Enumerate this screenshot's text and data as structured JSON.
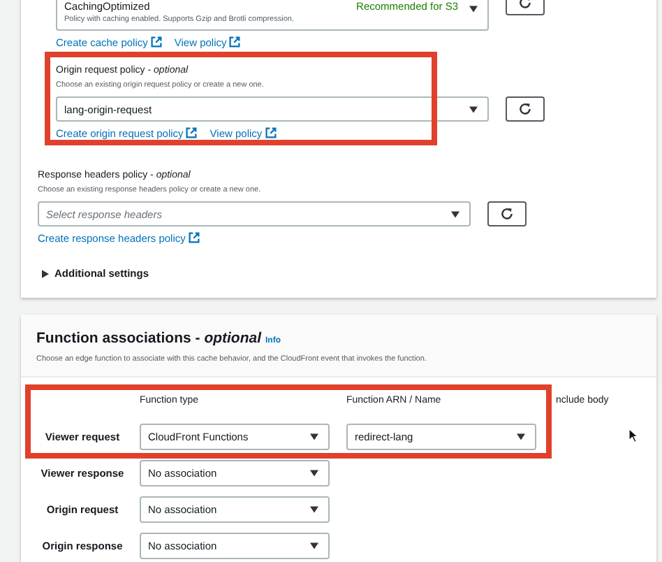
{
  "cache_policy": {
    "value": "CachingOptimized",
    "description": "Policy with caching enabled. Supports Gzip and Brotli compression.",
    "badge": "Recommended for S3",
    "links": [
      "Create cache policy",
      "View policy"
    ]
  },
  "origin_request_policy": {
    "label": "Origin request policy - *optional*",
    "description": "Choose an existing origin request policy or create a new one.",
    "value": "lang-origin-request",
    "links": [
      "Create origin request policy",
      "View policy"
    ],
    "highlighted": true
  },
  "response_headers_policy": {
    "label": "Response headers policy - *optional*",
    "description": "Choose an existing response headers policy or create a new one.",
    "placeholder": "Select response headers",
    "links": [
      "Create response headers policy"
    ]
  },
  "additional_settings": {
    "label": "Additional settings",
    "expanded": false
  },
  "function_associations": {
    "title": "Function associations - *optional*",
    "info": "Info",
    "description": "Choose an edge function to associate with this cache behavior, and the CloudFront event that invokes the function.",
    "highlighted": true,
    "columns": [
      "Function type",
      "Function ARN / Name",
      "nclude body"
    ],
    "rows": [
      {
        "event": "Viewer request",
        "type": "CloudFront Functions",
        "arn": "redirect-lang"
      },
      {
        "event": "Viewer response",
        "type": "No association"
      },
      {
        "event": "Origin request",
        "type": "No association"
      },
      {
        "event": "Origin response",
        "type": "No association"
      }
    ]
  }
}
